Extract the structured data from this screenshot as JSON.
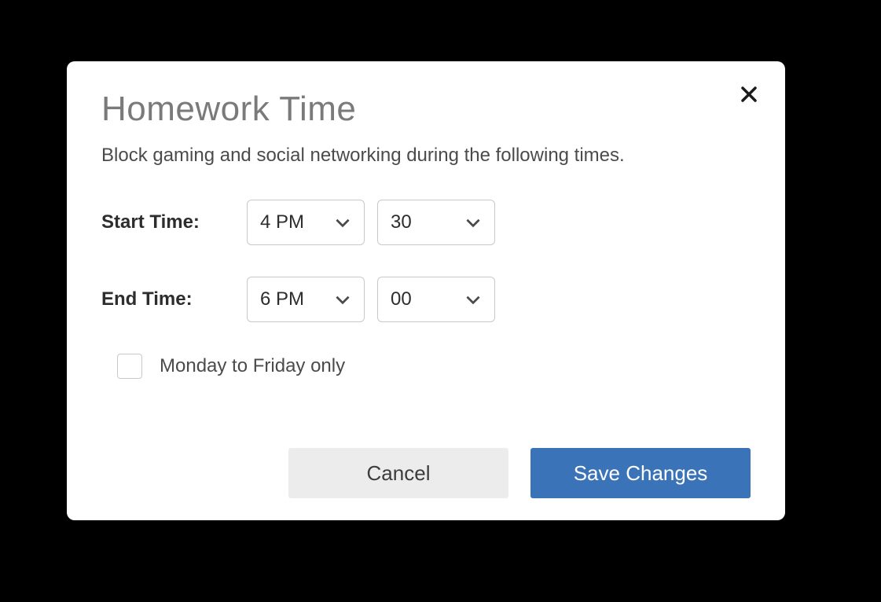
{
  "dialog": {
    "title": "Homework Time",
    "subtitle": "Block gaming and social networking during the following times.",
    "start_label": "Start Time:",
    "end_label": "End Time:",
    "start_hour": "4 PM",
    "start_minute": "30",
    "end_hour": "6 PM",
    "end_minute": "00",
    "weekday_label": "Monday to Friday only",
    "weekday_checked": false,
    "cancel_label": "Cancel",
    "save_label": "Save Changes"
  }
}
